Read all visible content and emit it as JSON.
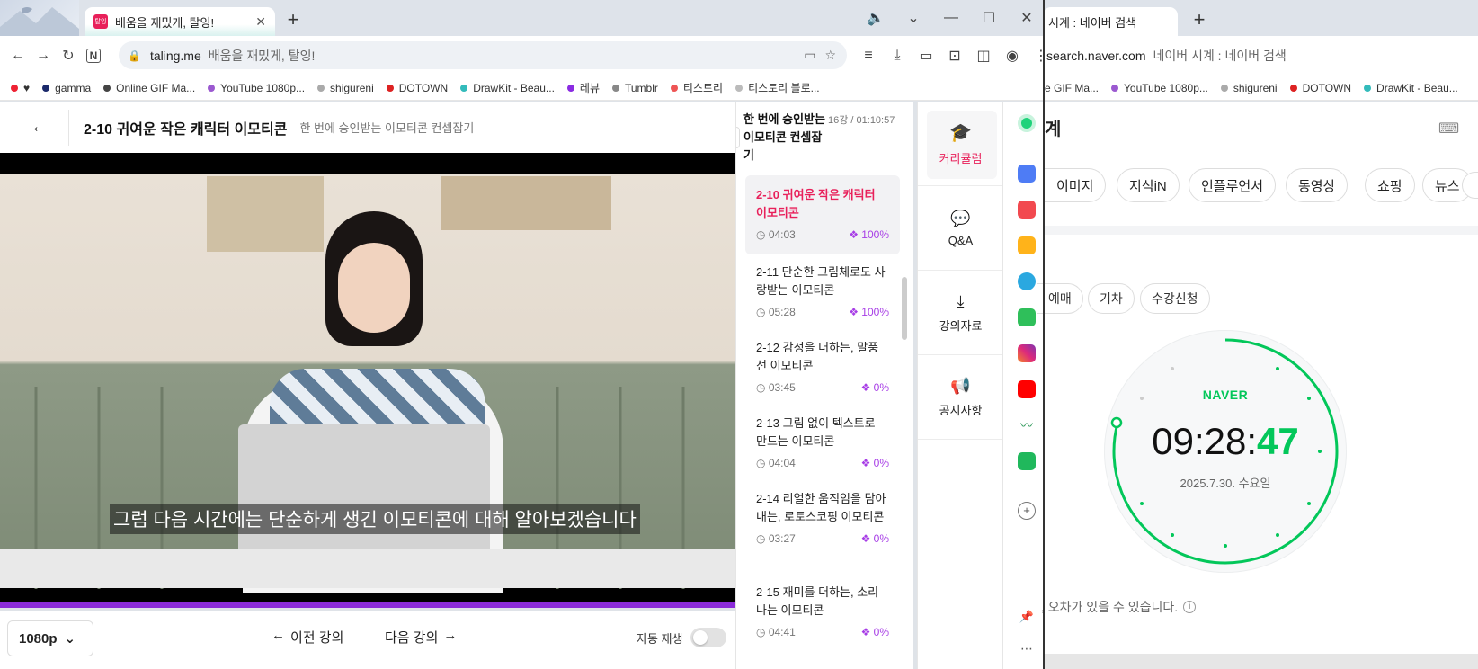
{
  "left_browser": {
    "tab_title": "배움을 재밌게, 탈잉!",
    "url_host": "taling.me",
    "url_title": "배움을 재밌게, 탈잉!",
    "bookmarks": [
      "♥",
      "gamma",
      "Online GIF Ma...",
      "YouTube 1080p...",
      "shigureni",
      "DOTOWN",
      "DrawKit - Beau...",
      "레뷰",
      "Tumblr",
      "티스토리",
      "티스토리 블로..."
    ]
  },
  "lecture": {
    "title": "2-10 귀여운 작은 캐릭터 이모티콘",
    "subtitle": "한 번에 승인받는 이모티콘 컨셉잡기",
    "caption": "그럼 다음 시간에는 단순하게 생긴 이모티콘에 대해 알아보겠습니다",
    "quality": "1080p",
    "prev_label": "이전 강의",
    "next_label": "다음 강의",
    "autoplay_label": "자동 재생"
  },
  "playlist": {
    "course_title": "한 번에 승인받는 이모티콘 컨셉잡기",
    "summary": "16강 / 01:10:57",
    "items": [
      {
        "title": "2-10 귀여운 작은 캐릭터 이모티콘",
        "duration": "04:03",
        "progress": "100%"
      },
      {
        "title": "2-11 단순한 그림체로도 사랑받는 이모티콘",
        "duration": "05:28",
        "progress": "100%"
      },
      {
        "title": "2-12 감정을 더하는, 말풍선 이모티콘",
        "duration": "03:45",
        "progress": "0%"
      },
      {
        "title": "2-13 그림 없이 텍스트로 만드는 이모티콘",
        "duration": "04:04",
        "progress": "0%"
      },
      {
        "title": "2-14 리얼한 움직임을 담아내는, 로토스코핑 이모티콘",
        "duration": "03:27",
        "progress": "0%"
      },
      {
        "title": "2-15 재미를 더하는, 소리 나는 이모티콘",
        "duration": "04:41",
        "progress": "0%"
      }
    ]
  },
  "side_menu": [
    "커리큘럼",
    "Q&A",
    "강의자료",
    "공지사항"
  ],
  "right_browser": {
    "tab_title": "시계 : 네이버 검색",
    "url_host": "search.naver.com",
    "url_title": "네이버 시계 : 네이버 검색",
    "bookmarks": [
      "e GIF Ma...",
      "YouTube 1080p...",
      "shigureni",
      "DOTOWN",
      "DrawKit - Beau..."
    ],
    "search_partial": "계",
    "tabs": [
      "이미지",
      "지식iN",
      "인플루언서",
      "동영상",
      "쇼핑",
      "뉴스"
    ],
    "chips": [
      "예매",
      "기차",
      "수강신청"
    ],
    "clock_brand": "NAVER",
    "clock_hm": "09:28:",
    "clock_sec": "47",
    "clock_date": "2025.7.30. 수요일",
    "notice": ", 오차가 있을 수 있습니다."
  },
  "colors": {
    "naver_green": "#03c75a",
    "taling_pink": "#e8205a",
    "progress_purple": "#a73de6"
  }
}
